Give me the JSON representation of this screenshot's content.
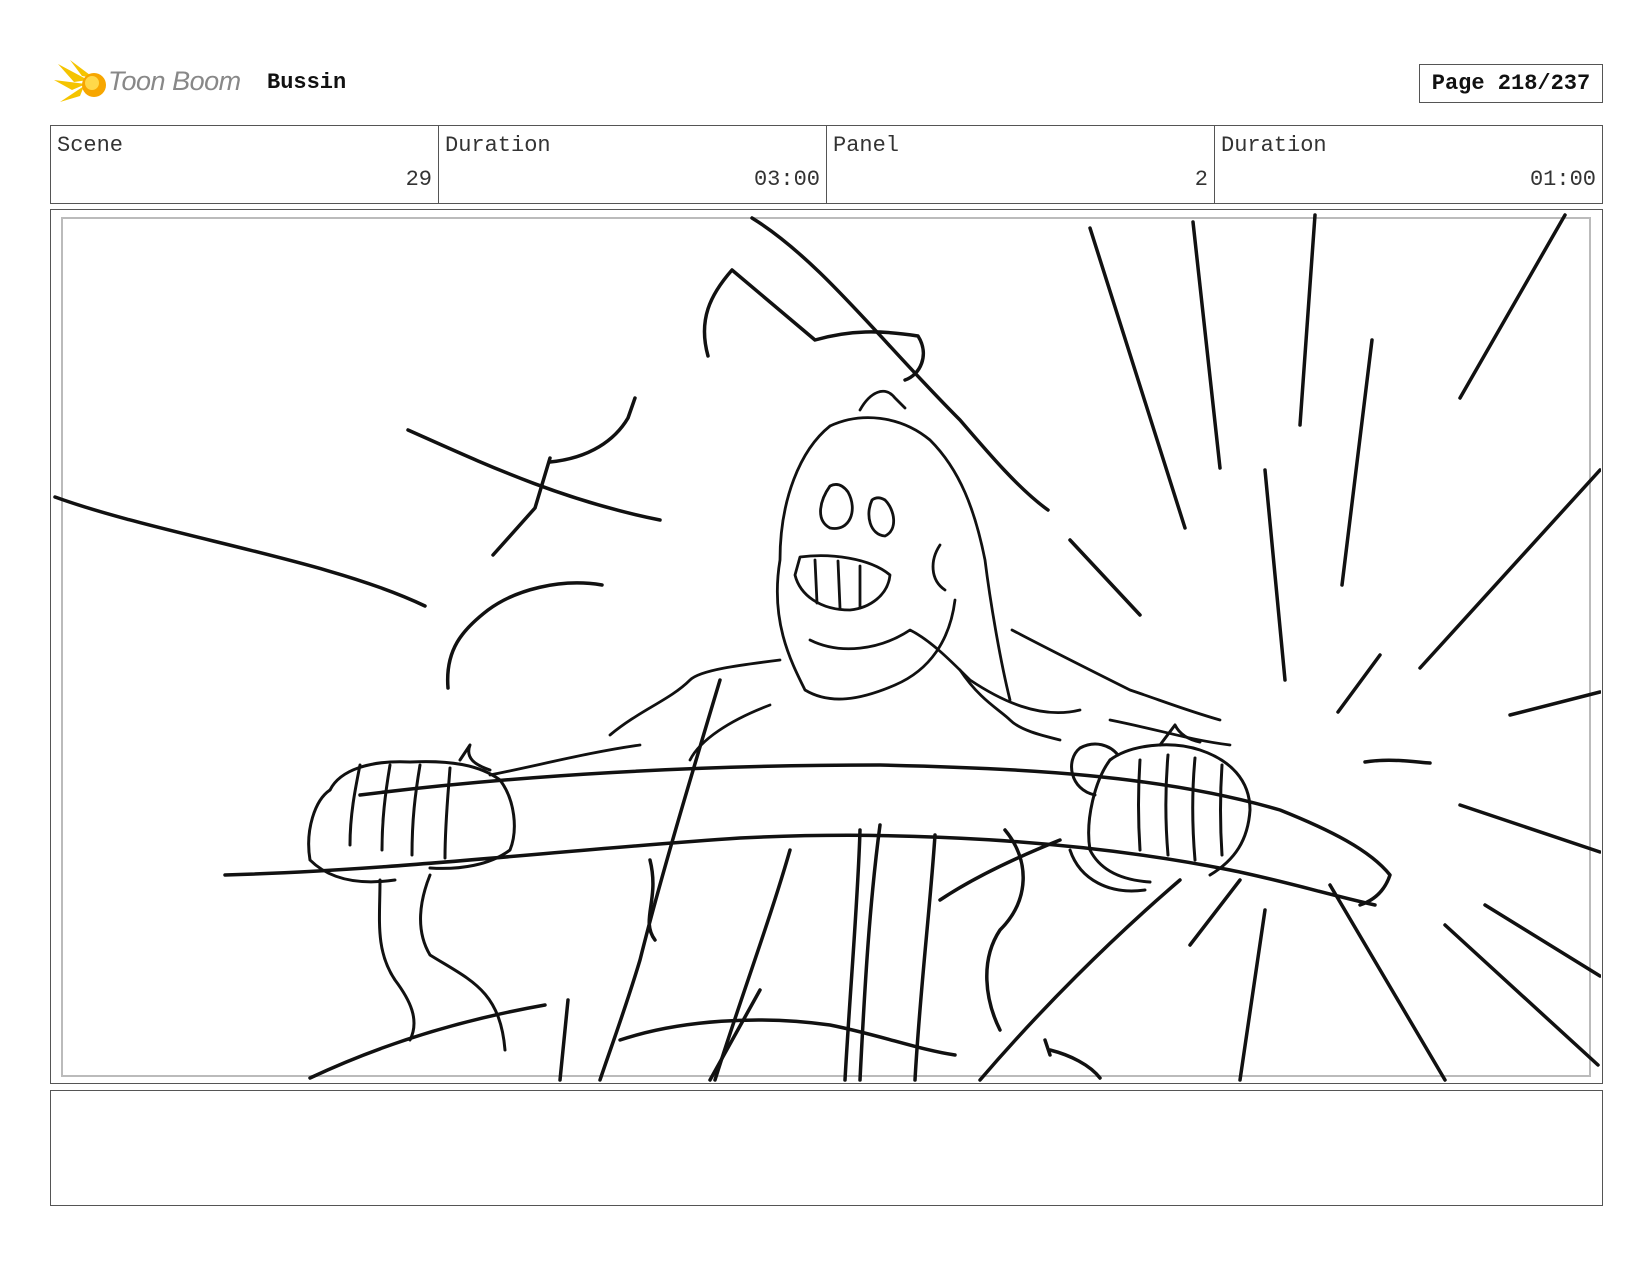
{
  "header": {
    "brand": "Toon Boom",
    "brand_icon": "toon-boom-star-icon",
    "project": "Bussin",
    "page": "Page 218/237"
  },
  "info": {
    "scene_label": "Scene",
    "scene_value": "29",
    "scene_duration_label": "Duration",
    "scene_duration_value": "03:00",
    "panel_label": "Panel",
    "panel_value": "2",
    "panel_duration_label": "Duration",
    "panel_duration_value": "01:00"
  },
  "notes": {
    "text": ""
  }
}
